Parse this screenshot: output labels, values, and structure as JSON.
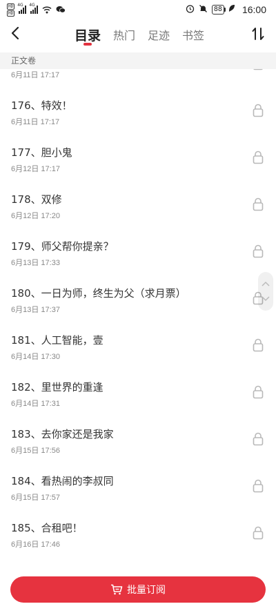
{
  "status_bar": {
    "sim1": "HD",
    "sim2": "HD",
    "net1": "4G",
    "net2": "4G",
    "battery": "88",
    "time": "16:00"
  },
  "nav": {
    "tabs": [
      {
        "label": "目录",
        "active": true
      },
      {
        "label": "热门",
        "active": false
      },
      {
        "label": "足迹",
        "active": false
      },
      {
        "label": "书签",
        "active": false
      }
    ]
  },
  "section": {
    "title": "正文卷"
  },
  "chapters": [
    {
      "title": "",
      "date": "6月11日 17:17",
      "locked": true
    },
    {
      "title": "176、特效！",
      "date": "6月11日 17:17",
      "locked": true
    },
    {
      "title": "177、胆小鬼",
      "date": "6月12日 17:17",
      "locked": true
    },
    {
      "title": "178、双修",
      "date": "6月12日 17:20",
      "locked": true
    },
    {
      "title": "179、师父帮你提亲？",
      "date": "6月13日 17:33",
      "locked": true
    },
    {
      "title": "180、一日为师，终生为父（求月票）",
      "date": "6月13日 17:37",
      "locked": true
    },
    {
      "title": "181、人工智能，壹",
      "date": "6月14日 17:30",
      "locked": true
    },
    {
      "title": "182、里世界的重逢",
      "date": "6月14日 17:31",
      "locked": true
    },
    {
      "title": "183、去你家还是我家",
      "date": "6月15日 17:56",
      "locked": true
    },
    {
      "title": "184、看热闹的李叔同",
      "date": "6月15日 17:57",
      "locked": true
    },
    {
      "title": "185、合租吧！",
      "date": "6月16日 17:46",
      "locked": true
    }
  ],
  "bottom": {
    "bulk_label": "批量订阅"
  },
  "colors": {
    "accent": "#e6333f",
    "section_bg": "#f4f4f4"
  }
}
